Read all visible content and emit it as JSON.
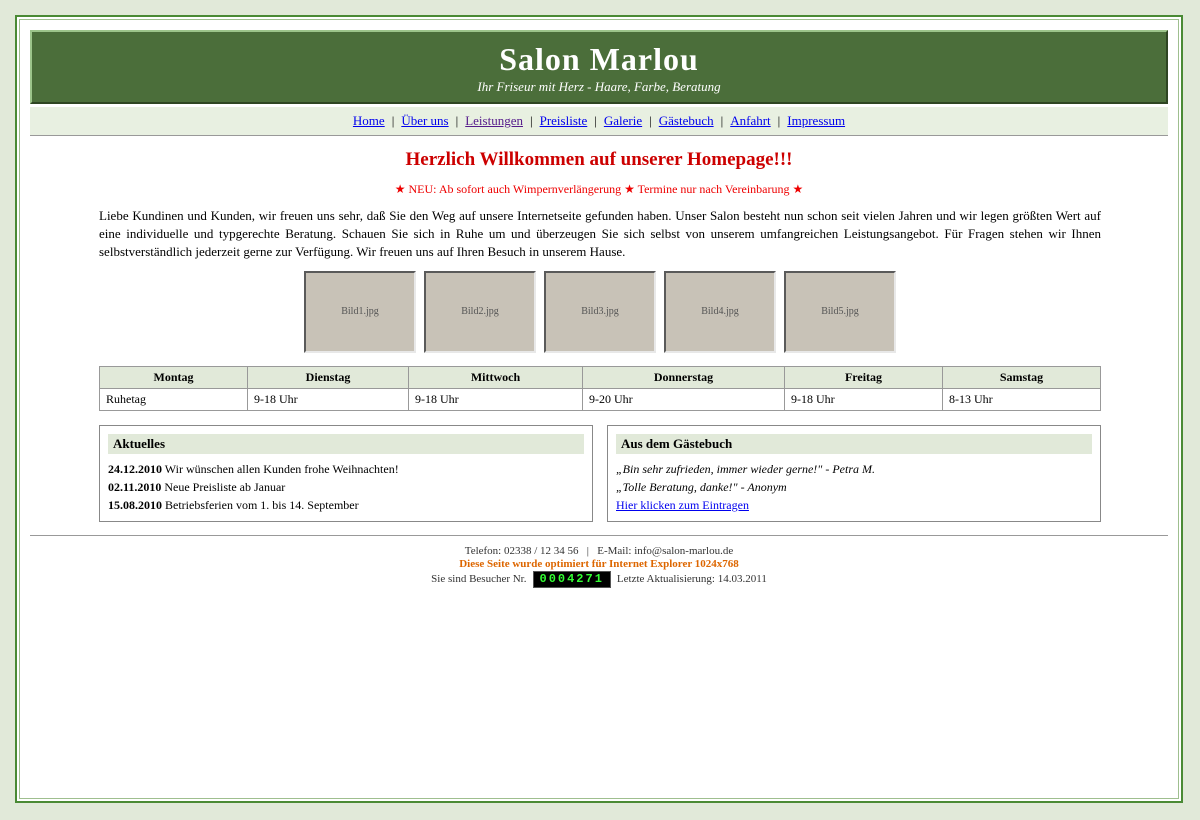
{
  "header": {
    "title": "Salon Marlou",
    "subtitle": "Ihr Friseur mit Herz - Haare, Farbe, Beratung"
  },
  "nav": {
    "items": [
      {
        "label": "Home"
      },
      {
        "label": "Über uns"
      },
      {
        "label": "Leistungen",
        "visited": true
      },
      {
        "label": "Preisliste"
      },
      {
        "label": "Galerie"
      },
      {
        "label": "Gästebuch"
      },
      {
        "label": "Anfahrt"
      },
      {
        "label": "Impressum"
      }
    ],
    "separator": "|"
  },
  "main": {
    "welcome": "Herzlich Willkommen auf unserer Homepage!!!",
    "ticker": "★ NEU: Ab sofort auch Wimpernverlängerung ★ Termine nur nach Vereinbarung ★",
    "intro": "Liebe Kundinen und Kunden, wir freuen uns sehr, daß Sie den Weg auf unsere Internetseite gefunden haben. Unser Salon besteht nun schon seit vielen Jahren und wir legen größten Wert auf eine individuelle und typgerechte Beratung. Schauen Sie sich in Ruhe um und überzeugen Sie sich selbst von unserem umfangreichen Leistungsangebot. Für Fragen stehen wir Ihnen selbstverständlich jederzeit gerne zur Verfügung. Wir freuen uns auf Ihren Besuch in unserem Hause."
  },
  "gallery": [
    "Bild1.jpg",
    "Bild2.jpg",
    "Bild3.jpg",
    "Bild4.jpg",
    "Bild5.jpg"
  ],
  "hours": {
    "days": [
      "Montag",
      "Dienstag",
      "Mittwoch",
      "Donnerstag",
      "Freitag",
      "Samstag"
    ],
    "times": [
      "Ruhetag",
      "9-18 Uhr",
      "9-18 Uhr",
      "9-20 Uhr",
      "9-18 Uhr",
      "8-13 Uhr"
    ]
  },
  "news": {
    "title": "Aktuelles",
    "items": [
      {
        "date": "24.12.2010",
        "text": "Wir wünschen allen Kunden frohe Weihnachten!"
      },
      {
        "date": "02.11.2010",
        "text": "Neue Preisliste ab Januar"
      },
      {
        "date": "15.08.2010",
        "text": "Betriebsferien vom 1. bis 14. September"
      }
    ]
  },
  "guestbook": {
    "title": "Aus dem Gästebuch",
    "entries": [
      "„Bin sehr zufrieden, immer wieder gerne!\" - Petra M.",
      "„Tolle Beratung, danke!\" - Anonym"
    ],
    "link": "Hier klicken zum Eintragen"
  },
  "footer": {
    "contact": "Telefon: 02338 / 12 34 56   |   E-Mail: info@salon-marlou.de",
    "optimized": "Diese Seite wurde optimiert für Internet Explorer 1024x768",
    "visitor_label": "Sie sind Besucher Nr.",
    "visitor_count": "0004271",
    "updated": "Letzte Aktualisierung: 14.03.2011"
  },
  "colors": {
    "page_bg": "#e1e9d9",
    "header_bg": "#4b6e3a",
    "welcome": "#cc0000",
    "optimized": "#dd6600",
    "counter": "#33ff33"
  }
}
